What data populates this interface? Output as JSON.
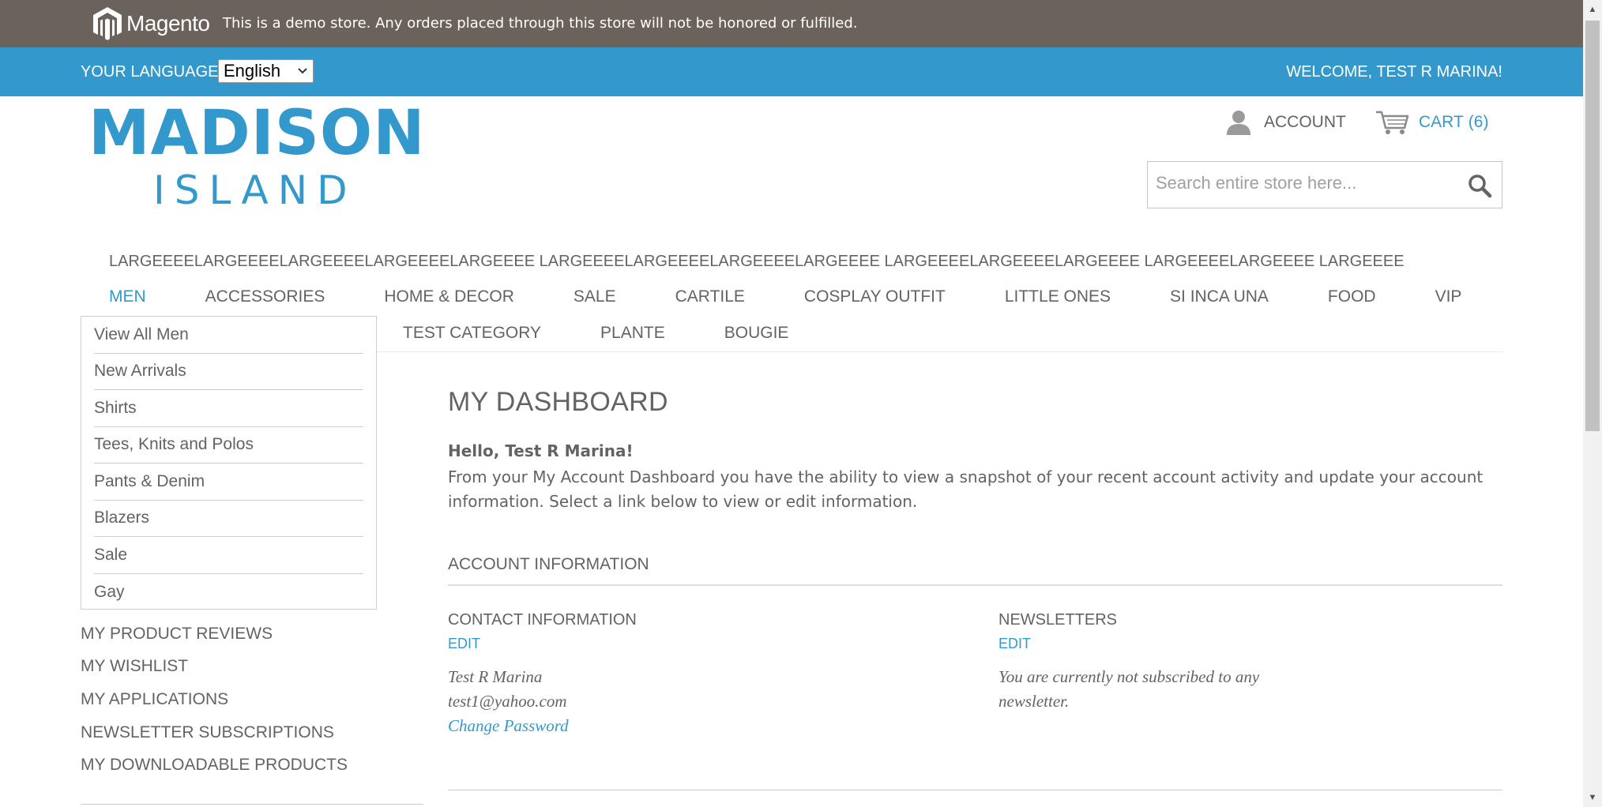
{
  "demo_bar": {
    "brand": "Magento",
    "notice": "This is a demo store. Any orders placed through this store will not be honored or fulfilled."
  },
  "lang_bar": {
    "label": "YOUR LANGUAGE:",
    "selected": "English",
    "welcome": "WELCOME, TEST R MARINA!"
  },
  "logo": {
    "line1": "MADISON",
    "line2": "ISLAND"
  },
  "header": {
    "account_label": "ACCOUNT",
    "cart_label": "CART",
    "cart_count": "(6)",
    "search_placeholder": "Search entire store here..."
  },
  "nav": {
    "large_row": "LARGEEEELARGEEEELARGEEEELARGEEEELARGEEEE LARGEEEELARGEEEELARGEEEELARGEEEE LARGEEEELARGEEEELARGEEEE LARGEEEELARGEEEE LARGEEEE",
    "items": [
      "MEN",
      "ACCESSORIES",
      "HOME & DECOR",
      "SALE",
      "CARTILE",
      "COSPLAY OUTFIT",
      "LITTLE ONES",
      "SI INCA UNA",
      "FOOD",
      "VIP"
    ],
    "items_row2": [
      "TEST CATEGORY",
      "PLANTE",
      "BOUGIE"
    ]
  },
  "dropdown": {
    "items": [
      "View All Men",
      "New Arrivals",
      "Shirts",
      "Tees, Knits and Polos",
      "Pants & Denim",
      "Blazers",
      "Sale",
      "Gay"
    ]
  },
  "sidebar": {
    "links": [
      "MY PRODUCT REVIEWS",
      "MY WISHLIST",
      "MY APPLICATIONS",
      "NEWSLETTER SUBSCRIPTIONS",
      "MY DOWNLOADABLE PRODUCTS"
    ]
  },
  "main": {
    "title": "MY DASHBOARD",
    "hello": "Hello, Test R Marina!",
    "intro": "From your My Account Dashboard you have the ability to view a snapshot of your recent account activity and update your account information. Select a link below to view or edit information.",
    "section_title": "ACCOUNT INFORMATION",
    "contact": {
      "title": "CONTACT INFORMATION",
      "edit": "EDIT",
      "name": "Test R Marina",
      "email": "test1@yahoo.com",
      "change_password": "Change Password"
    },
    "newsletters": {
      "title": "NEWSLETTERS",
      "edit": "EDIT",
      "text": "You are currently not subscribed to any newsletter."
    }
  },
  "colors": {
    "accent": "#3399cc",
    "demo_bar": "#6b625b",
    "text": "#636363"
  }
}
